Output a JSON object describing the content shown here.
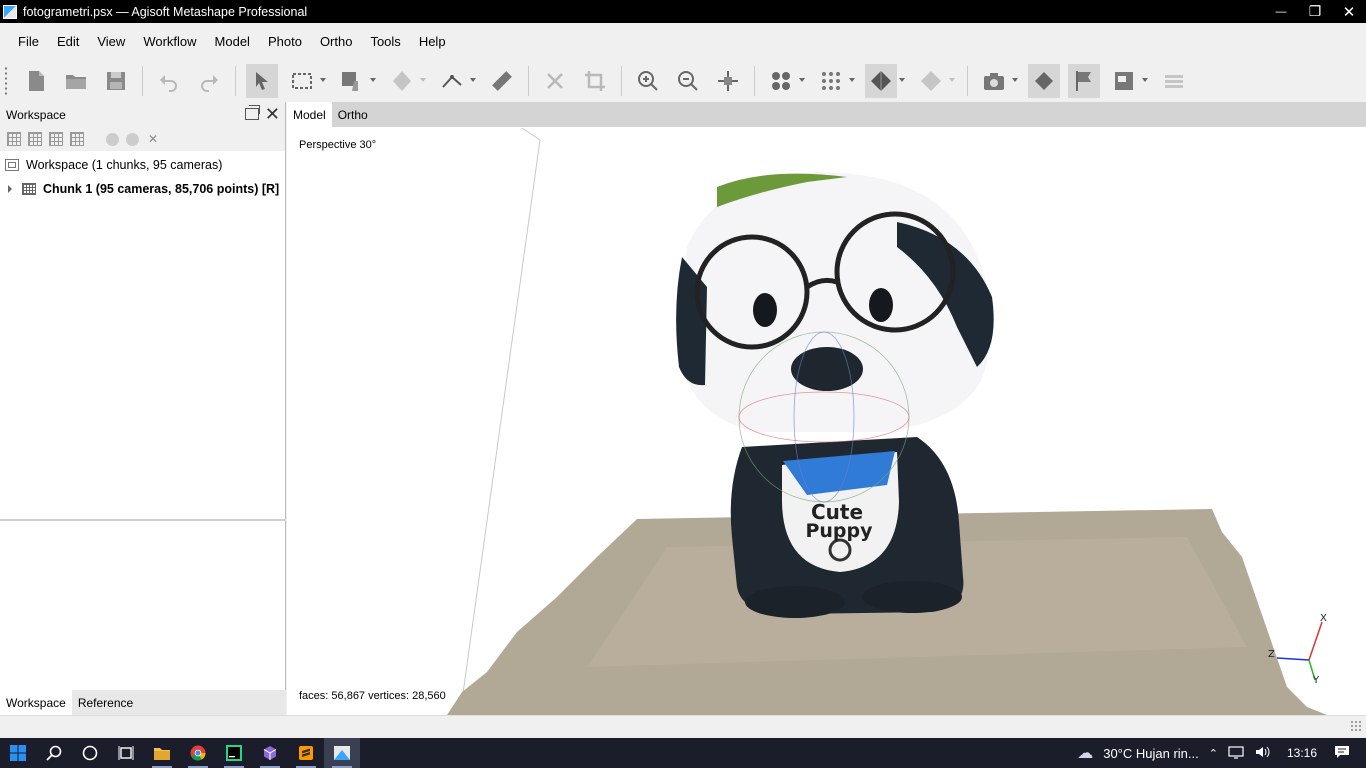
{
  "window": {
    "title": "fotogrametri.psx — Agisoft Metashape Professional",
    "controls": {
      "minimize": "—",
      "restore": "❐",
      "close": "✕"
    }
  },
  "menubar": {
    "items": [
      {
        "label": "File"
      },
      {
        "label": "Edit"
      },
      {
        "label": "View"
      },
      {
        "label": "Workflow"
      },
      {
        "label": "Model"
      },
      {
        "label": "Photo"
      },
      {
        "label": "Ortho"
      },
      {
        "label": "Tools"
      },
      {
        "label": "Help"
      }
    ]
  },
  "toolbar": {
    "icons": [
      "new-document-icon",
      "open-folder-icon",
      "save-icon",
      "undo-icon",
      "redo-icon",
      "select-cursor-icon",
      "rectangle-select-icon",
      "paint-select-icon",
      "transform-object-icon",
      "ruler-icon",
      "delete-selection-icon",
      "crop-icon",
      "zoom-in-icon",
      "zoom-out-icon",
      "reset-view-icon",
      "show-cameras-icon",
      "show-points-icon",
      "show-model-icon",
      "show-tiled-icon",
      "camera-icon",
      "show-shapes-icon",
      "show-markers-icon",
      "show-images-icon",
      "show-regions-icon"
    ]
  },
  "workspace_panel": {
    "title": "Workspace",
    "tree": {
      "root": "Workspace (1 chunks, 95 cameras)",
      "chunk": "Chunk 1 (95 cameras, 85,706 points) [R]"
    },
    "tabs": [
      {
        "label": "Workspace"
      },
      {
        "label": "Reference"
      }
    ]
  },
  "viewport": {
    "tabs": [
      {
        "label": "Model"
      },
      {
        "label": "Ortho"
      }
    ],
    "projection_label": "Perspective 30°",
    "stats": "faces: 56,867 vertices: 28,560",
    "model_text_line1": "Cute",
    "model_text_line2": "Puppy",
    "axes": {
      "x": "X",
      "y": "Y",
      "z": "Z"
    }
  },
  "taskbar": {
    "weather": "30°C  Hujan rin...",
    "time": "13:16"
  },
  "colors": {
    "titlebar": "#000000",
    "taskbar": "#1b1e2a",
    "accent": "#2f7bd6"
  }
}
